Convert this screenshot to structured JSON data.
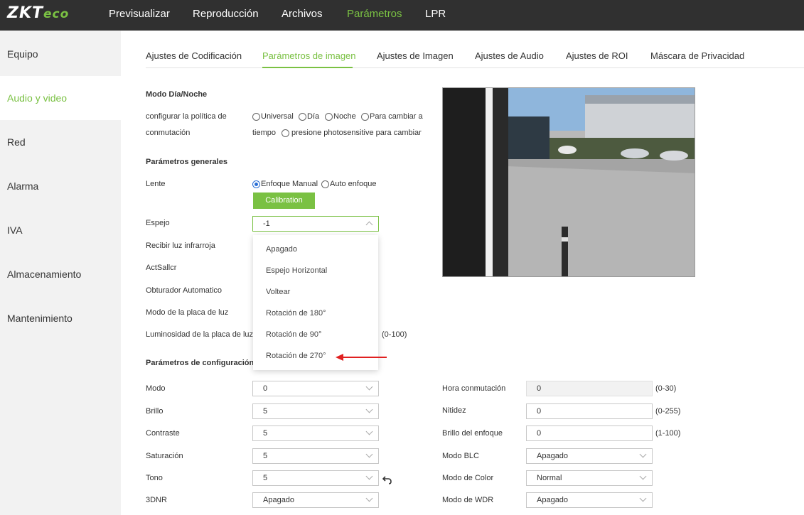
{
  "brand": {
    "logo_main": "ZKT",
    "logo_eco": "eco"
  },
  "topnav": [
    "Previsualizar",
    "Reproducción",
    "Archivos",
    "Parámetros",
    "LPR"
  ],
  "sidebar": [
    "Equipo",
    "Audio y video",
    "Red",
    "Alarma",
    "IVA",
    "Almacenamiento",
    "Mantenimiento"
  ],
  "tabs": [
    "Ajustes de Codificación",
    "Parámetros de imagen",
    "Ajustes de Imagen",
    "Ajustes de Audio",
    "Ajustes de ROI",
    "Máscara de Privacidad"
  ],
  "daynight": {
    "title": "Modo Día/Noche",
    "policy_label_1": "configurar la política de",
    "policy_label_2": "conmutación",
    "options": [
      "Universal",
      "Día",
      "Noche",
      "Para cambiar a",
      "tiempo",
      "presione photosensitive para cambiar"
    ]
  },
  "general": {
    "title": "Parámetros generales",
    "lens_label": "Lente",
    "lens_options": [
      "Enfoque Manual",
      "Auto enfoque"
    ],
    "calibration_label": "Calibration",
    "mirror_label": "Espejo",
    "mirror_value": "-1",
    "ir_label": "Recibir luz infrarroja",
    "actsallcr_label": "ActSallcr",
    "shutter_label": "Obturador Automatico",
    "lightplate_mode_label": "Modo de la placa de luz",
    "lightplate_brightness_label": "Luminosidad de la placa de luz",
    "lightplate_range": "(0-100)"
  },
  "mirror_dropdown": [
    "Apagado",
    "Espejo Horizontal",
    "Voltear",
    "Rotación de 180°",
    "Rotación de 90°",
    "Rotación de 270°"
  ],
  "config": {
    "title": "Parámetros de configuración",
    "left": [
      {
        "label": "Modo",
        "value": "0"
      },
      {
        "label": "Brillo",
        "value": "5"
      },
      {
        "label": "Contraste",
        "value": "5"
      },
      {
        "label": "Saturación",
        "value": "5"
      },
      {
        "label": "Tono",
        "value": "5"
      },
      {
        "label": "3DNR",
        "value": "Apagado"
      }
    ],
    "right": [
      {
        "label": "Hora conmutación",
        "value": "0",
        "range": "(0-30)"
      },
      {
        "label": "Nitidez",
        "value": "0",
        "range": "(0-255)"
      },
      {
        "label": "Brillo del enfoque",
        "value": "0",
        "range": "(1-100)"
      },
      {
        "label": "Modo BLC",
        "value": "Apagado",
        "range": ""
      },
      {
        "label": "Modo de Color",
        "value": "Normal",
        "range": ""
      },
      {
        "label": "Modo de WDR",
        "value": "Apagado",
        "range": ""
      }
    ]
  },
  "colors": {
    "accent": "#7ac143",
    "topbar": "#303030",
    "annotation_arrow": "#e02020"
  }
}
